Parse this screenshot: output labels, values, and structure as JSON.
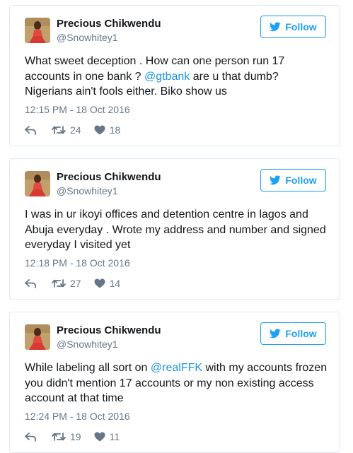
{
  "tweets": [
    {
      "name": "Precious Chikwendu",
      "handle": "@Snowhitey1",
      "follow_label": "Follow",
      "text_before": "What sweet deception . How can one person run 17 accounts in one bank ? ",
      "mention": "@gtbank",
      "text_after": " are u that dumb? Nigerians ain't fools either. Biko show us",
      "time": "12:15 PM - 18 Oct 2016",
      "retweets": "24",
      "likes": "18"
    },
    {
      "name": "Precious Chikwendu",
      "handle": "@Snowhitey1",
      "follow_label": "Follow",
      "text_before": "I was in ur ikoyi offices and detention centre in lagos and Abuja everyday . Wrote my address and number and signed everyday I visited yet",
      "mention": "",
      "text_after": "",
      "time": "12:18 PM - 18 Oct 2016",
      "retweets": "27",
      "likes": "14"
    },
    {
      "name": "Precious Chikwendu",
      "handle": "@Snowhitey1",
      "follow_label": "Follow",
      "text_before": "While labeling all sort on ",
      "mention": "@realFFK",
      "text_after": " with my accounts frozen you didn't mention 17 accounts or my non existing access account at that time",
      "time": "12:24 PM - 18 Oct 2016",
      "retweets": "19",
      "likes": "11"
    }
  ],
  "icons": {
    "follow": "twitter-bird-icon",
    "reply": "reply-icon",
    "retweet": "retweet-icon",
    "like": "heart-icon"
  },
  "colors": {
    "accent": "#1da1f2",
    "mention": "#1b95e0",
    "muted": "#657786",
    "border": "#e1e8ed"
  }
}
